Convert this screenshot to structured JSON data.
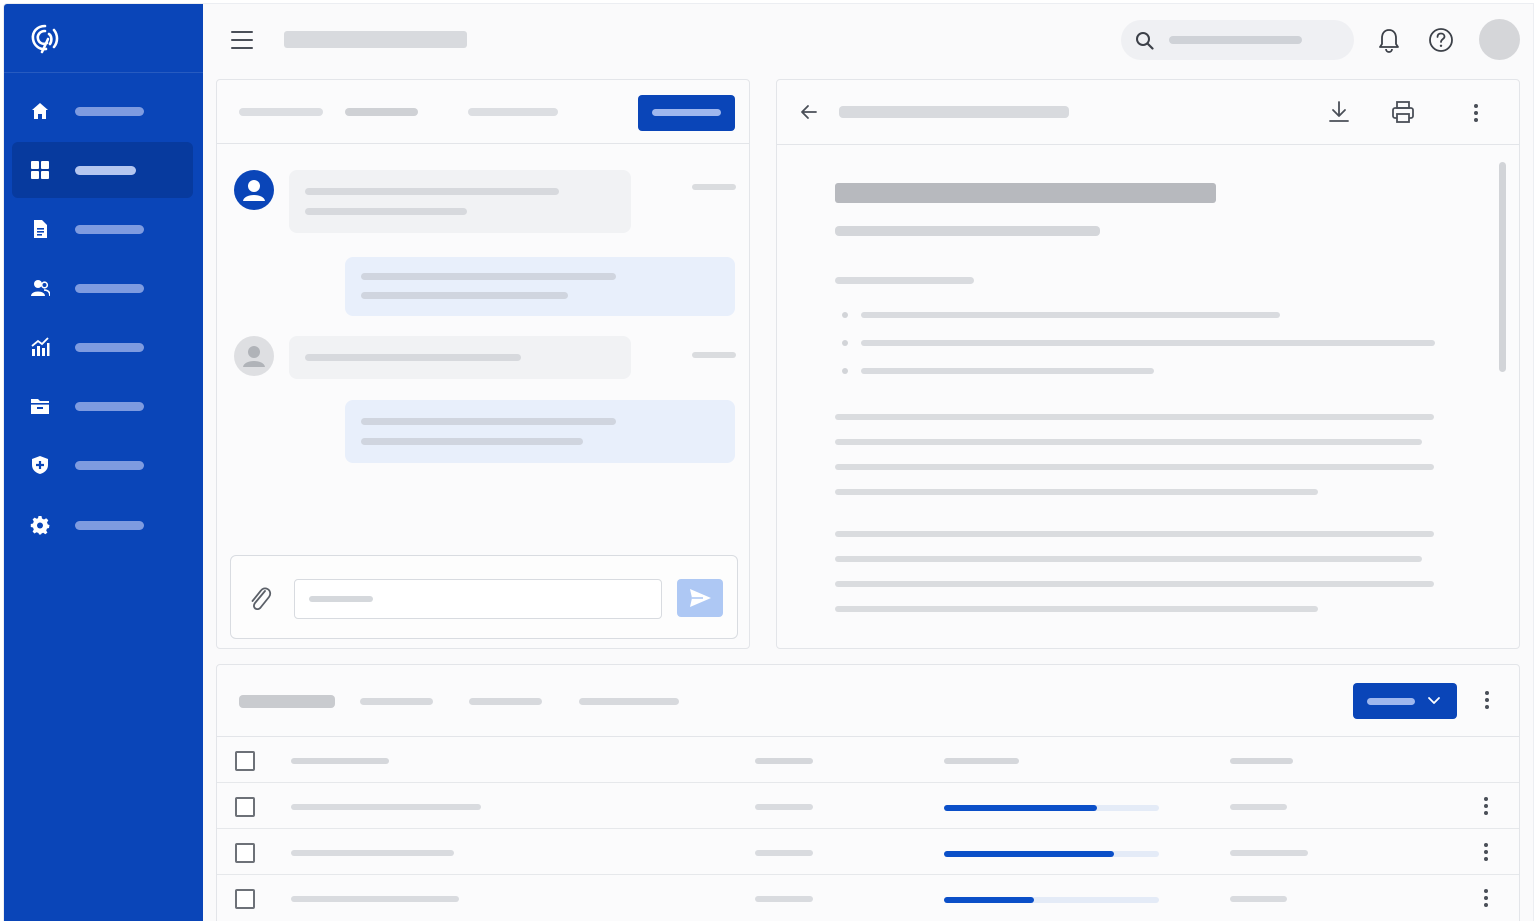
{
  "colors": {
    "sidebar_bg": "#0a45b8",
    "sidebar_active": "#073a9e",
    "accent": "#0a45b8",
    "progress": "#0b4fc8",
    "bubble_outgoing": "#e8effb",
    "bubble_incoming": "#f1f2f4"
  },
  "sidebar": {
    "logo_icon": "spiral-logo-icon",
    "items": [
      {
        "icon": "home-icon",
        "active": false
      },
      {
        "icon": "dashboard-grid-icon",
        "active": true
      },
      {
        "icon": "document-icon",
        "active": false
      },
      {
        "icon": "users-icon",
        "active": false
      },
      {
        "icon": "analytics-chart-icon",
        "active": false
      },
      {
        "icon": "folder-icon",
        "active": false
      },
      {
        "icon": "shield-icon",
        "active": false
      },
      {
        "icon": "settings-gear-icon",
        "active": false
      }
    ]
  },
  "topbar": {
    "menu_icon": "hamburger-menu-icon",
    "search_icon": "search-icon",
    "notification_icon": "bell-icon",
    "help_icon": "help-circle-icon"
  },
  "chat": {
    "send_icon": "send-icon",
    "attach_icon": "paperclip-icon"
  },
  "document": {
    "back_icon": "arrow-left-icon",
    "download_icon": "download-icon",
    "print_icon": "printer-icon",
    "more_icon": "more-vertical-icon"
  },
  "table": {
    "dropdown_icon": "chevron-down-icon",
    "rows": [
      {
        "progress": 0.71
      },
      {
        "progress": 0.79
      },
      {
        "progress": 0.42
      }
    ]
  }
}
